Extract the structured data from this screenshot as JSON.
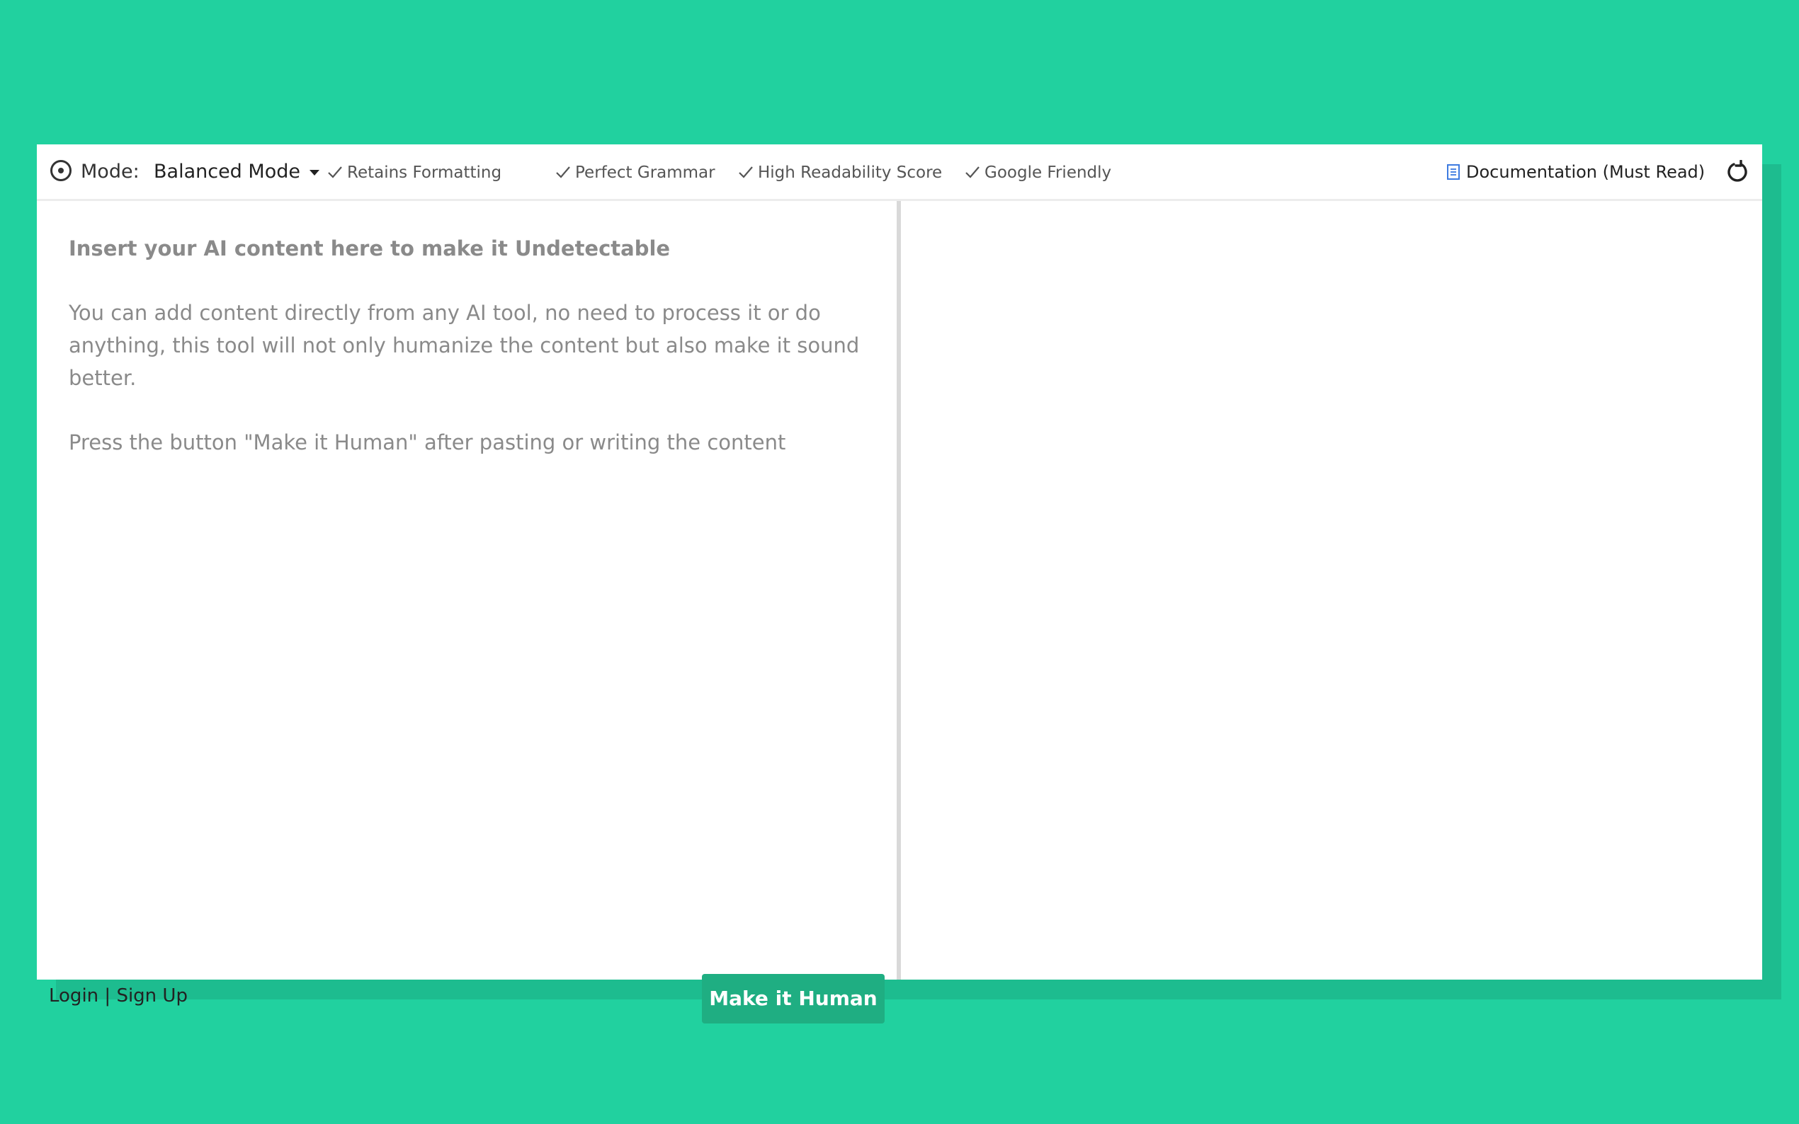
{
  "toolbar": {
    "mode_label": "Mode:",
    "mode_value": "Balanced Mode",
    "features": [
      "Retains Formatting",
      "Perfect Grammar",
      "High Readability Score",
      "Google Friendly"
    ],
    "doc_link": "Documentation (Must Read)"
  },
  "editor": {
    "placeholder_title": "Insert your AI content here to make it Undetectable",
    "placeholder_line1": "You can add content directly from any AI tool, no need to process it or do anything, this tool will not only humanize the content but also make it sound better.",
    "placeholder_line2": "Press the button \"Make it Human\" after pasting or writing the content"
  },
  "footer": {
    "login": "Login",
    "separator": "|",
    "signup": "Sign Up",
    "make_human_button": "Make it Human"
  },
  "colors": {
    "background": "#21d19f",
    "accent_button": "#1fae82",
    "doc_icon": "#3d7be0"
  },
  "icons": {
    "mode": "radio-target-icon",
    "dropdown": "caret-down-icon",
    "feature": "checkmark-icon",
    "doc": "document-icon",
    "reset": "refresh-icon"
  }
}
